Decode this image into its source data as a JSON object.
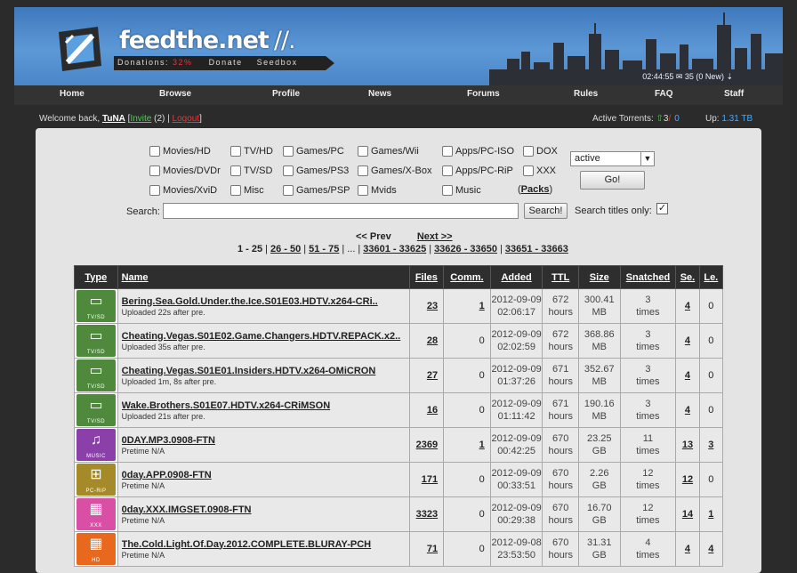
{
  "site": {
    "name": "feedthe.net",
    "slashes": "//.",
    "donations_label": "Donations:",
    "donations_pct": "32%",
    "donate_link": "Donate",
    "seedbox_link": "Seedbox",
    "clock": "02:44:55",
    "messages": "35 (0 New)"
  },
  "nav": {
    "items": [
      "Home",
      "Browse",
      "Profile",
      "News",
      "Forums",
      "Rules",
      "FAQ",
      "Staff"
    ]
  },
  "user": {
    "welcome": "Welcome back,",
    "name": "TuNA",
    "invite": "Invite",
    "invite_count": "(2)",
    "logout": "Logout",
    "active_label": "Active Torrents:",
    "seeding": "3",
    "leeching": "0",
    "up_label": "Up:",
    "up_value": "1.31 TB"
  },
  "filters": {
    "categories": [
      [
        "Movies/HD",
        "TV/HD",
        "Games/PC",
        "Games/Wii",
        "Apps/PC-ISO",
        "DOX"
      ],
      [
        "Movies/DVDr",
        "TV/SD",
        "Games/PS3",
        "Games/X-Box",
        "Apps/PC-RiP",
        "XXX"
      ],
      [
        "Movies/XviD",
        "Misc",
        "Games/PSP",
        "Mvids",
        "Music"
      ]
    ],
    "packs": "Packs",
    "select_value": "active",
    "go_label": "Go!",
    "search_label": "Search:",
    "search_button": "Search!",
    "search_value": "",
    "titles_only_label": "Search titles only:",
    "titles_only_checked": "✓"
  },
  "pager": {
    "prev": "<< Prev",
    "next": "Next >>",
    "current": "1 - 25",
    "links": [
      "26 - 50",
      "51 - 75",
      "...",
      "33601 - 33625",
      "33626 - 33650",
      "33651 - 33663"
    ]
  },
  "table": {
    "headers": [
      "Type",
      "Name",
      "Files",
      "Comm.",
      "Added",
      "TTL",
      "Size",
      "Snatched",
      "Se.",
      "Le."
    ],
    "rows": [
      {
        "cat": "TV/SD",
        "icon": "tv-icon",
        "color": "#4f8a3c",
        "name": "Bering.Sea.Gold.Under.the.Ice.S01E03.HDTV.x264-CRi..",
        "meta": "Uploaded 22s after pre.",
        "files": "23",
        "comm": "1",
        "date": "2012-09-09",
        "time": "02:06:17",
        "ttl": "672",
        "ttl_unit": "hours",
        "size": "300.41",
        "size_unit": "MB",
        "snatched": "3",
        "snatched_unit": "times",
        "se": "4",
        "le": "0"
      },
      {
        "cat": "TV/SD",
        "icon": "tv-icon",
        "color": "#4f8a3c",
        "name": "Cheating.Vegas.S01E02.Game.Changers.HDTV.REPACK.x2..",
        "meta": "Uploaded 35s after pre.",
        "files": "28",
        "comm": "0",
        "date": "2012-09-09",
        "time": "02:02:59",
        "ttl": "672",
        "ttl_unit": "hours",
        "size": "368.86",
        "size_unit": "MB",
        "snatched": "3",
        "snatched_unit": "times",
        "se": "4",
        "le": "0"
      },
      {
        "cat": "TV/SD",
        "icon": "tv-icon",
        "color": "#4f8a3c",
        "name": "Cheating.Vegas.S01E01.Insiders.HDTV.x264-OMiCRON",
        "meta": "Uploaded 1m, 8s after pre.",
        "files": "27",
        "comm": "0",
        "date": "2012-09-09",
        "time": "01:37:26",
        "ttl": "671",
        "ttl_unit": "hours",
        "size": "352.67",
        "size_unit": "MB",
        "snatched": "3",
        "snatched_unit": "times",
        "se": "4",
        "le": "0"
      },
      {
        "cat": "TV/SD",
        "icon": "tv-icon",
        "color": "#4f8a3c",
        "name": "Wake.Brothers.S01E07.HDTV.x264-CRiMSON",
        "meta": "Uploaded 21s after pre.",
        "files": "16",
        "comm": "0",
        "date": "2012-09-09",
        "time": "01:11:42",
        "ttl": "671",
        "ttl_unit": "hours",
        "size": "190.16",
        "size_unit": "MB",
        "snatched": "3",
        "snatched_unit": "times",
        "se": "4",
        "le": "0"
      },
      {
        "cat": "MUSIC",
        "icon": "music-note-icon",
        "color": "#8b3fa8",
        "name": "0DAY.MP3.0908-FTN",
        "meta": "Pretime N/A",
        "files": "2369",
        "comm": "1",
        "date": "2012-09-09",
        "time": "00:42:25",
        "ttl": "670",
        "ttl_unit": "hours",
        "size": "23.25",
        "size_unit": "GB",
        "snatched": "11",
        "snatched_unit": "times",
        "se": "13",
        "le": "3"
      },
      {
        "cat": "PC-RiP",
        "icon": "windows-icon",
        "color": "#a58a2a",
        "name": "0day.APP.0908-FTN",
        "meta": "Pretime N/A",
        "files": "171",
        "comm": "0",
        "date": "2012-09-09",
        "time": "00:33:51",
        "ttl": "670",
        "ttl_unit": "hours",
        "size": "2.26",
        "size_unit": "GB",
        "snatched": "12",
        "snatched_unit": "times",
        "se": "12",
        "le": "0"
      },
      {
        "cat": "XXX",
        "icon": "film-icon",
        "color": "#d84fa5",
        "name": "0day.XXX.IMGSET.0908-FTN",
        "meta": "Pretime N/A",
        "files": "3323",
        "comm": "0",
        "date": "2012-09-09",
        "time": "00:29:38",
        "ttl": "670",
        "ttl_unit": "hours",
        "size": "16.70",
        "size_unit": "GB",
        "snatched": "12",
        "snatched_unit": "times",
        "se": "14",
        "le": "1"
      },
      {
        "cat": "HD",
        "icon": "film-icon",
        "color": "#e8681e",
        "name": "The.Cold.Light.Of.Day.2012.COMPLETE.BLURAY-PCH",
        "meta": "Pretime N/A",
        "files": "71",
        "comm": "0",
        "date": "2012-09-08",
        "time": "23:53:50",
        "ttl": "670",
        "ttl_unit": "hours",
        "size": "31.31",
        "size_unit": "GB",
        "snatched": "4",
        "snatched_unit": "times",
        "se": "4",
        "le": "4"
      }
    ]
  }
}
